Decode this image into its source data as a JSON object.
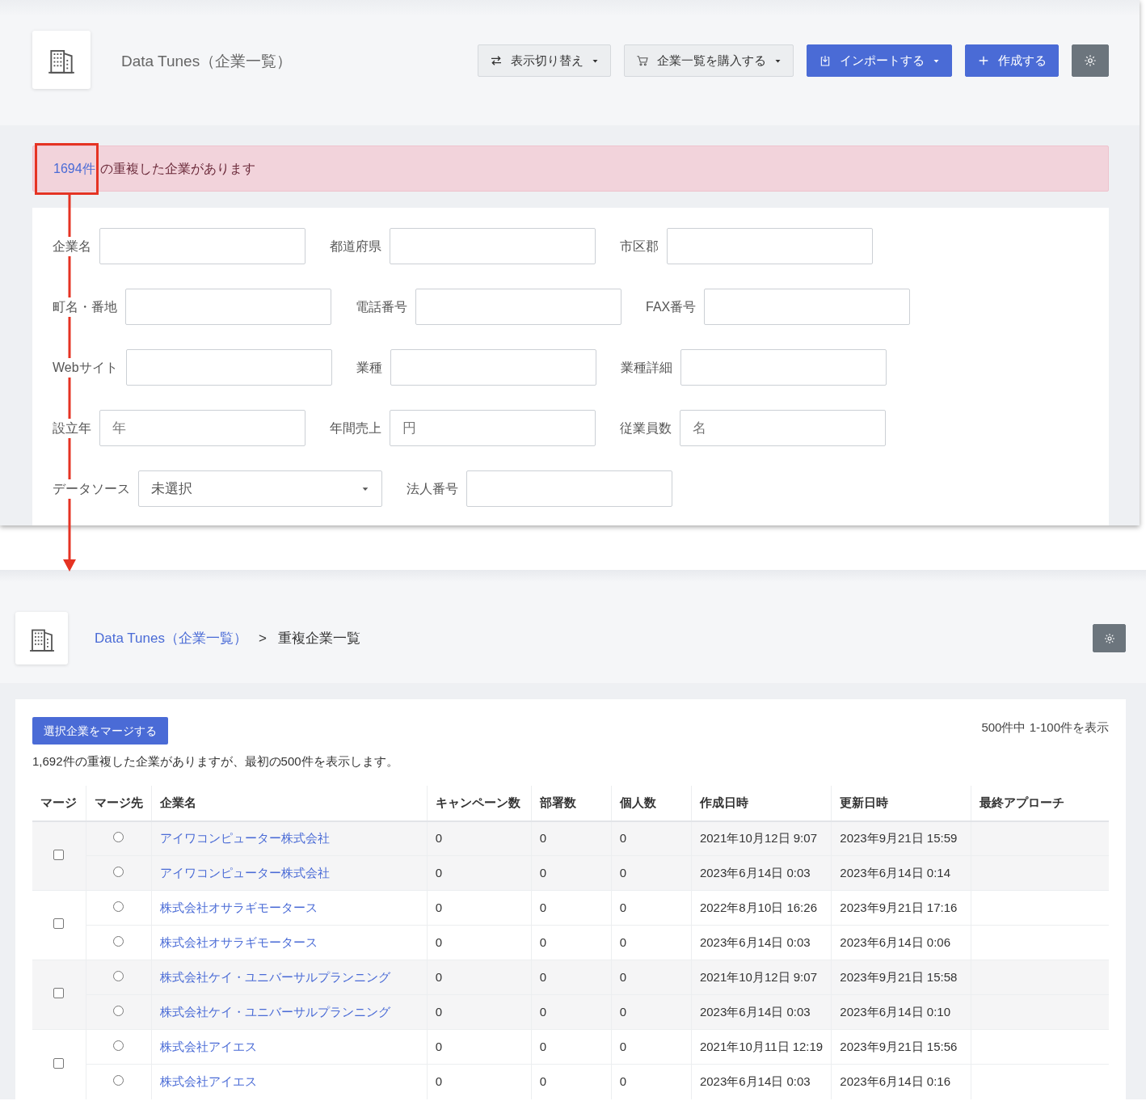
{
  "top_screen": {
    "title": "Data Tunes（企業一覧）",
    "buttons": [
      {
        "kind": "toggle",
        "label": "表示切り替え",
        "dropdown": true
      },
      {
        "kind": "cart",
        "label": "企業一覧を購入する",
        "dropdown": true
      },
      {
        "kind": "import",
        "label": "インポートする",
        "dropdown": true
      },
      {
        "kind": "create",
        "label": "作成する",
        "dropdown": false
      },
      {
        "kind": "settings",
        "dropdown": false
      }
    ],
    "alert": {
      "count_link": "1694件",
      "message": "の重複した企業があります"
    },
    "search_form": [
      [
        {
          "label": "企業名",
          "kind": "text"
        },
        {
          "label": "都道府県",
          "kind": "text"
        },
        {
          "label": "市区郡",
          "kind": "text"
        }
      ],
      [
        {
          "label": "町名・番地",
          "kind": "text"
        },
        {
          "label": "電話番号",
          "kind": "text"
        },
        {
          "label": "FAX番号",
          "kind": "text"
        }
      ],
      [
        {
          "label": "Webサイト",
          "kind": "text"
        },
        {
          "label": "業種",
          "kind": "text"
        },
        {
          "label": "業種詳細",
          "kind": "text"
        }
      ],
      [
        {
          "label": "設立年",
          "kind": "text",
          "placeholder": "年"
        },
        {
          "label": "年間売上",
          "kind": "text",
          "placeholder": "円"
        },
        {
          "label": "従業員数",
          "kind": "text",
          "placeholder": "名"
        }
      ],
      [
        {
          "label": "データソース",
          "kind": "select",
          "value": "未選択"
        },
        {
          "label": "法人番号",
          "kind": "text"
        }
      ]
    ]
  },
  "bottom_screen": {
    "breadcrumb": {
      "parent": "Data Tunes（企業一覧）",
      "separator": ">",
      "current": "重複企業一覧"
    },
    "merge_button": "選択企業をマージする",
    "range_text": "500件中 1-100件を表示",
    "notice": "1,692件の重複した企業がありますが、最初の500件を表示します。",
    "table": {
      "columns": [
        "マージ",
        "マージ先",
        "企業名",
        "キャンペーン数",
        "部署数",
        "個人数",
        "作成日時",
        "更新日時",
        "最終アプローチ"
      ],
      "groups": [
        {
          "checked": false,
          "rows": [
            {
              "selected": false,
              "name": "アイワコンピューター株式会社",
              "campaigns": "0",
              "departments": "0",
              "people": "0",
              "created": "2021年10月12日 9:07",
              "updated": "2023年9月21日 15:59"
            },
            {
              "selected": false,
              "name": "アイワコンピューター株式会社",
              "campaigns": "0",
              "departments": "0",
              "people": "0",
              "created": "2023年6月14日 0:03",
              "updated": "2023年6月14日 0:14"
            }
          ]
        },
        {
          "checked": false,
          "rows": [
            {
              "selected": false,
              "name": "株式会社オサラギモータース",
              "campaigns": "0",
              "departments": "0",
              "people": "0",
              "created": "2022年8月10日 16:26",
              "updated": "2023年9月21日 17:16"
            },
            {
              "selected": false,
              "name": "株式会社オサラギモータース",
              "campaigns": "0",
              "departments": "0",
              "people": "0",
              "created": "2023年6月14日 0:03",
              "updated": "2023年6月14日 0:06"
            }
          ]
        },
        {
          "checked": false,
          "rows": [
            {
              "selected": false,
              "name": "株式会社ケイ・ユニバーサルプランニング",
              "campaigns": "0",
              "departments": "0",
              "people": "0",
              "created": "2021年10月12日 9:07",
              "updated": "2023年9月21日 15:58"
            },
            {
              "selected": false,
              "name": "株式会社ケイ・ユニバーサルプランニング",
              "campaigns": "0",
              "departments": "0",
              "people": "0",
              "created": "2023年6月14日 0:03",
              "updated": "2023年6月14日 0:10"
            }
          ]
        },
        {
          "checked": false,
          "rows": [
            {
              "selected": false,
              "name": "株式会社アイエス",
              "campaigns": "0",
              "departments": "0",
              "people": "0",
              "created": "2021年10月11日 12:19",
              "updated": "2023年9月21日 15:56"
            },
            {
              "selected": false,
              "name": "株式会社アイエス",
              "campaigns": "0",
              "departments": "0",
              "people": "0",
              "created": "2023年6月14日 0:03",
              "updated": "2023年6月14日 0:16"
            }
          ]
        }
      ]
    }
  }
}
